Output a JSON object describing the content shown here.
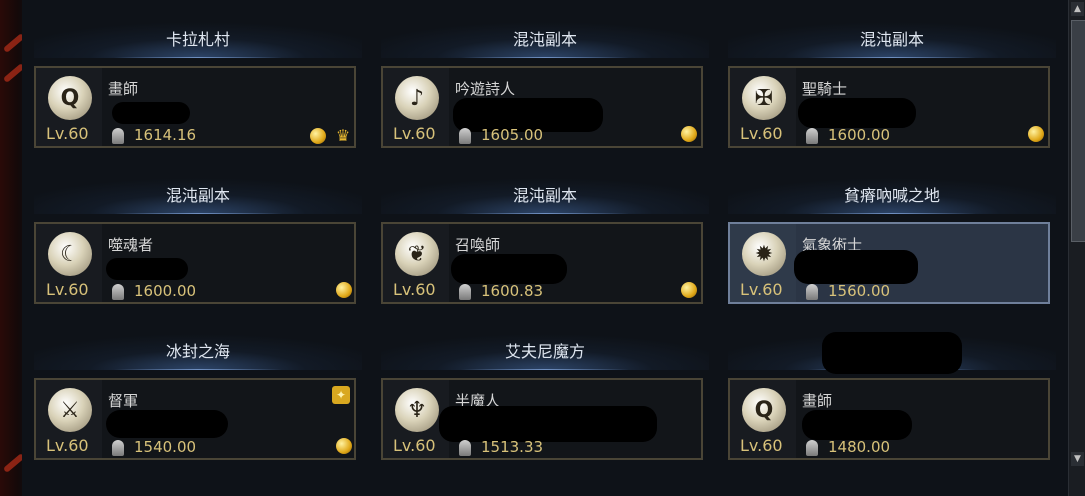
{
  "characters": [
    {
      "location": "卡拉札村",
      "class": "畫師",
      "level": "Lv.60",
      "score": "1614.16",
      "emblem": "artist-emblem-icon",
      "glyph": "Q",
      "badges": [
        "coin-icon",
        "crown-icon"
      ]
    },
    {
      "location": "混沌副本",
      "class": "吟遊詩人",
      "level": "Lv.60",
      "score": "1605.00",
      "emblem": "bard-emblem-icon",
      "glyph": "♪",
      "badges": [
        "coin-icon"
      ]
    },
    {
      "location": "混沌副本",
      "class": "聖騎士",
      "level": "Lv.60",
      "score": "1600.00",
      "emblem": "paladin-emblem-icon",
      "glyph": "✠",
      "badges": [
        "coin-icon"
      ]
    },
    {
      "location": "混沌副本",
      "class": "噬魂者",
      "level": "Lv.60",
      "score": "1600.00",
      "emblem": "souleater-emblem-icon",
      "glyph": "☾",
      "badges": [
        "coin-icon"
      ]
    },
    {
      "location": "混沌副本",
      "class": "召喚師",
      "level": "Lv.60",
      "score": "1600.83",
      "emblem": "summoner-emblem-icon",
      "glyph": "❦",
      "badges": [
        "coin-icon"
      ]
    },
    {
      "location": "貧瘠吶喊之地",
      "class": "氣象術士",
      "level": "Lv.60",
      "score": "1560.00",
      "emblem": "aeromancer-emblem-icon",
      "glyph": "✹",
      "badges": []
    },
    {
      "location": "冰封之海",
      "class": "督軍",
      "level": "Lv.60",
      "score": "1540.00",
      "emblem": "warlord-emblem-icon",
      "glyph": "⚔",
      "badges": [
        "coin-icon"
      ]
    },
    {
      "location": "艾夫尼魔方",
      "class": "半魔人",
      "level": "Lv.60",
      "score": "1513.33",
      "emblem": "demonic-emblem-icon",
      "glyph": "♆",
      "badges": []
    },
    {
      "location": "",
      "class": "畫師",
      "level": "Lv.60",
      "score": "1480.00",
      "emblem": "artist-emblem-icon",
      "glyph": "Q",
      "badges": []
    }
  ],
  "selected_index": 5
}
